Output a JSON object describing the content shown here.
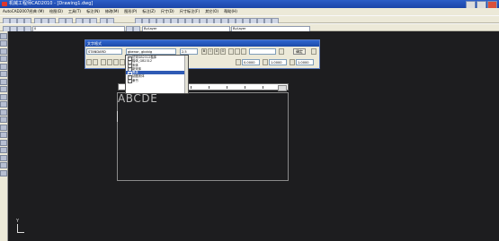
{
  "window": {
    "title": "机械工程师CAD2010 - [Drawing1.dwg]"
  },
  "menubar": {
    "items": [
      "AutoCAD2007经典 (M)",
      "绘图(D)",
      "工具(T)",
      "标注(N)",
      "修改(M)",
      "图形(P)",
      "标注(Z)",
      "尺寸(D)",
      "尺寸标注(F)",
      "其它(O)",
      "帮助(H)"
    ]
  },
  "toolbar": {
    "layer_combo": "0",
    "style_combo_1": "ByLayer",
    "style_combo_2": "ByLayer"
  },
  "text_format": {
    "title": "文字格式",
    "style": "STANDARD",
    "font": "gbenor, gbcbig",
    "height": "2.5",
    "ok_label": "确定",
    "angle": "0.0000",
    "tracking": "1.0000",
    "width": "1.0000"
  },
  "font_dropdown": {
    "items": [
      "仿宋GB2312楷体",
      "楷体_GB2312",
      "宋体",
      "新宋体",
      "黑体",
      "幼圆宋体",
      "隶书"
    ],
    "selected_index": 4
  },
  "editor": {
    "text": "ABCDE"
  },
  "ucs": {
    "y_label": "Y"
  },
  "colors": {
    "canvas": "#1d1d1f",
    "titlebar": "#2c5ec7",
    "chrome": "#ece9d8",
    "selection": "#2f5bb5"
  }
}
